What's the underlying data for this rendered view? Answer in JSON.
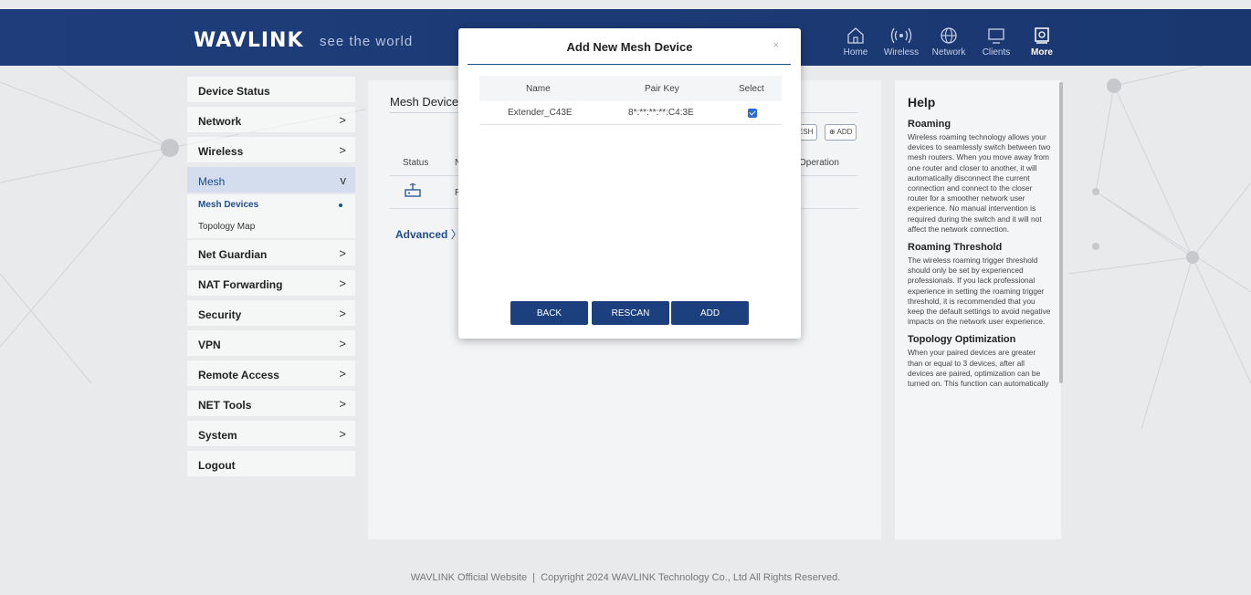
{
  "header": {
    "logo": "WAVLINK",
    "tagline": "see the world",
    "nav": [
      {
        "label": "Home",
        "icon": "home-icon"
      },
      {
        "label": "Wireless",
        "icon": "wireless-icon"
      },
      {
        "label": "Network",
        "icon": "globe-icon"
      },
      {
        "label": "Clients",
        "icon": "clients-icon"
      },
      {
        "label": "More",
        "icon": "more-icon"
      }
    ]
  },
  "sidebar": {
    "items": [
      {
        "label": "Device Status"
      },
      {
        "label": "Network",
        "chevron": ">"
      },
      {
        "label": "Wireless",
        "chevron": ">"
      },
      {
        "label": "Mesh",
        "chevron": "v"
      },
      {
        "label": "Net Guardian",
        "chevron": ">"
      },
      {
        "label": "NAT Forwarding",
        "chevron": ">"
      },
      {
        "label": "Security",
        "chevron": ">"
      },
      {
        "label": "VPN",
        "chevron": ">"
      },
      {
        "label": "Remote Access",
        "chevron": ">"
      },
      {
        "label": "NET Tools",
        "chevron": ">"
      },
      {
        "label": "System",
        "chevron": ">"
      },
      {
        "label": "Logout"
      }
    ],
    "mesh_sub": [
      {
        "label": "Mesh Devices"
      },
      {
        "label": "Topology Map"
      }
    ]
  },
  "main": {
    "title": "Mesh Device",
    "btn_mesh": "ESH",
    "btn_add": "ADD",
    "col_status": "Status",
    "col_n": "N",
    "col_operation": "Operation",
    "row_r": "R",
    "advanced": "Advanced"
  },
  "modal": {
    "title": "Add New Mesh Device",
    "close": "×",
    "columns": {
      "name": "Name",
      "pair_key": "Pair Key",
      "select": "Select"
    },
    "rows": [
      {
        "name": "Extender_C43E",
        "pair_key": "8*:**:**:**:C4:3E",
        "selected": true
      }
    ],
    "buttons": {
      "back": "BACK",
      "rescan": "RESCAN",
      "add": "ADD"
    }
  },
  "help": {
    "title": "Help",
    "sections": [
      {
        "heading": "Roaming",
        "text": "Wireless roaming technology allows your devices to seamlessly switch between two mesh routers. When you move away from one router and closer to another, it will automatically disconnect the current connection and connect to the closer router for a smoother network user experience. No manual intervention is required during the switch and it will not affect the network connection."
      },
      {
        "heading": "Roaming Threshold",
        "text": "The wireless roaming trigger threshold should only be set by experienced professionals. If you lack professional experience in setting the roaming trigger threshold, it is recommended that you keep the default settings to avoid negative impacts on the network user experience."
      },
      {
        "heading": "Topology Optimization",
        "text": "When your paired devices are greater than or equal to 3 devices, after all devices are paired, optimization can be turned on. This function can automatically"
      }
    ]
  },
  "footer": {
    "text": "WAVLINK Official Website  |  Copyright 2024 WAVLINK Technology Co., Ltd All Rights Reserved."
  },
  "colors": {
    "header_bg": "#1e3d7a",
    "accent": "#1f4d8f",
    "button_bg": "#1c3f7e",
    "checkbox": "#2a6bd1"
  }
}
